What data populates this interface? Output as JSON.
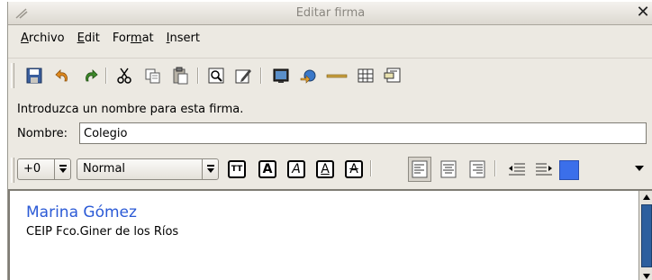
{
  "window": {
    "title": "Editar firma"
  },
  "menu": {
    "items": [
      {
        "pre": "",
        "u": "A",
        "post": "rchivo"
      },
      {
        "pre": "",
        "u": "E",
        "post": "dit"
      },
      {
        "pre": "For",
        "u": "m",
        "post": "at"
      },
      {
        "pre": "",
        "u": "I",
        "post": "nsert"
      }
    ]
  },
  "toolbar": {
    "buttons": [
      "save-icon",
      "undo-icon",
      "redo-icon",
      "cut-icon",
      "copy-icon",
      "paste-icon",
      "find-icon",
      "edit-icon",
      "image-icon",
      "link-icon",
      "horizontal-rule-icon",
      "table-icon",
      "html-tag-icon"
    ]
  },
  "form": {
    "hint": "Introduzca un nombre para esta firma.",
    "name_label": "Nombre:",
    "name_value": "Colegio"
  },
  "format": {
    "size_value": "+0",
    "style_value": "Normal",
    "text_buttons": [
      "TT",
      "A",
      "A",
      "A",
      "A"
    ],
    "color": "#3b6fea"
  },
  "editor": {
    "line1": "Marina Gómez",
    "line2": "CEIP Fco.Giner de los Ríos",
    "line1_color": "#2b5ad6"
  }
}
